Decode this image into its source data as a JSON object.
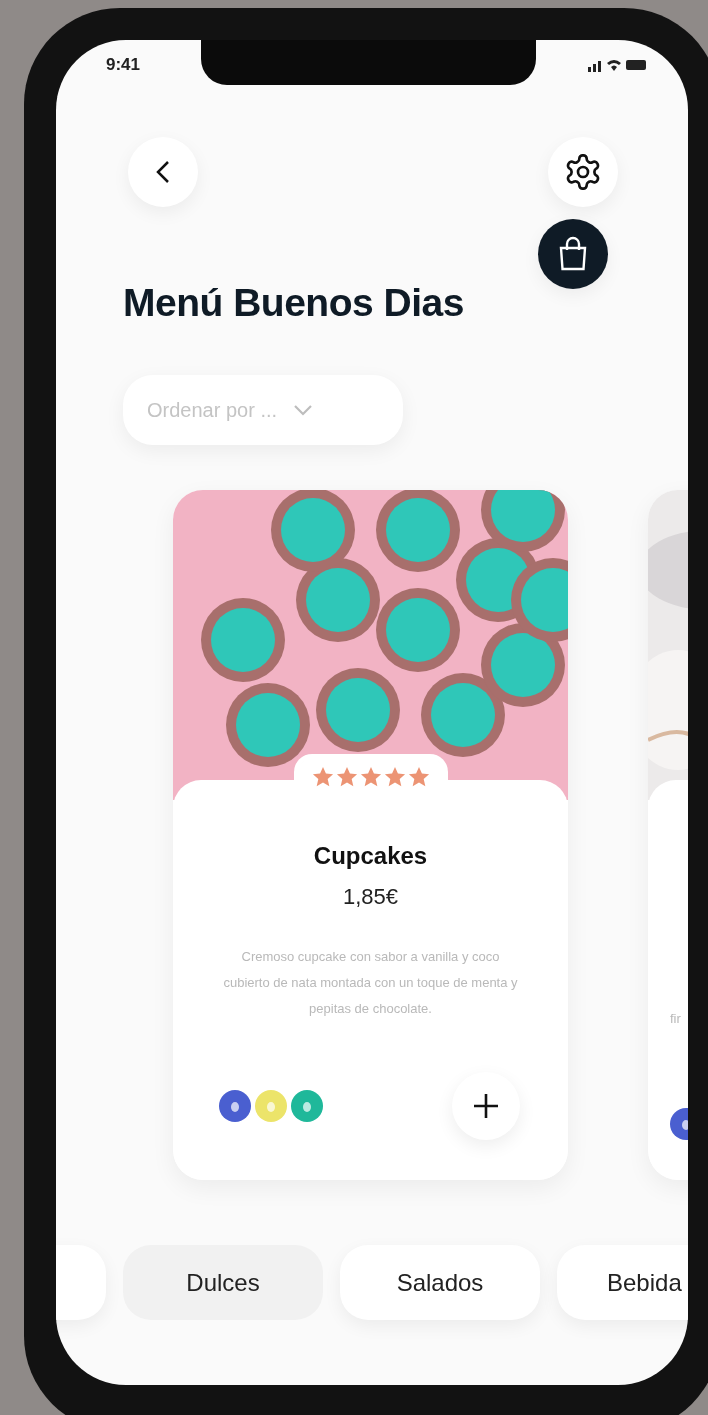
{
  "status_bar": {
    "time": "9:41"
  },
  "title": "Menú Buenos Dias",
  "sort_dropdown": {
    "placeholder": "Ordenar por ..."
  },
  "products": [
    {
      "kind": "cupcakes",
      "name": "Cupcakes",
      "price": "1,85€",
      "stars": 5,
      "description": "Cremoso cupcake con sabor a vanilla y coco cubierto de nata montada con un toque de menta y pepitas de chocolate.",
      "ingredients": [
        {
          "color": "#4a5fd0"
        },
        {
          "color": "#ece46a"
        },
        {
          "color": "#1fb89a"
        }
      ]
    },
    {
      "kind": "marble",
      "description": "fir",
      "ingredients": [
        {
          "color": "#4a5fd0"
        }
      ]
    }
  ],
  "categories": [
    {
      "selected": false
    },
    {
      "label": "Dulces",
      "selected": true
    },
    {
      "label": "Salados",
      "selected": false
    },
    {
      "label": "Bebida",
      "selected": false
    }
  ]
}
